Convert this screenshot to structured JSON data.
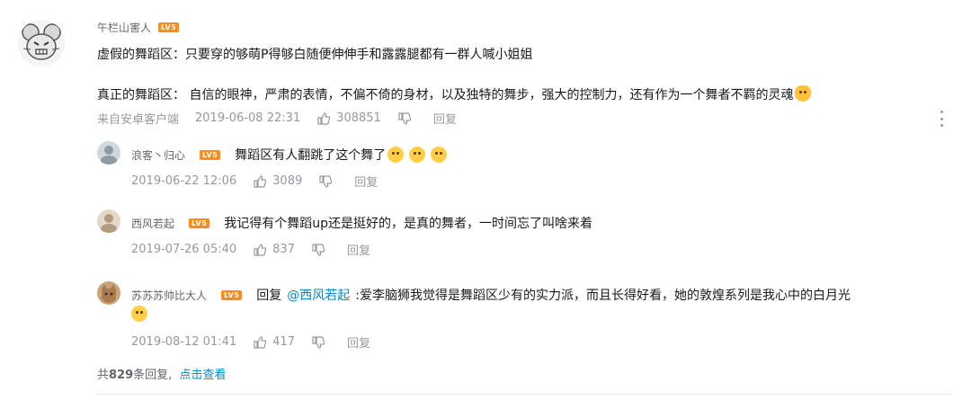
{
  "main_comment": {
    "username": "午栏山害人",
    "level": "LV5",
    "line1": "虚假的舞蹈区：只要穿的够萌P得够白随便伸伸手和露露腿都有一群人喊小姐姐",
    "line2": "真正的舞蹈区： 自信的眼神，严肃的表情，不偏不倚的身材，以及独特的舞步，强大的控制力，还有作为一个舞者不羁的灵魂",
    "source": "来自安卓客户端",
    "time": "2019-06-08 22:31",
    "likes": "308851",
    "reply_label": "回复",
    "emoji": "cat-emoji"
  },
  "replies": [
    {
      "username": "浪客丶归心",
      "level": "LV5",
      "text": "舞蹈区有人翻跳了这个舞了",
      "time": "2019-06-22 12:06",
      "likes": "3089",
      "reply_label": "回复"
    },
    {
      "username": "西风若起",
      "level": "LV5",
      "text": "我记得有个舞蹈up还是挺好的，是真的舞者，一时间忘了叫啥来着",
      "time": "2019-07-26 05:40",
      "likes": "837",
      "reply_label": "回复"
    },
    {
      "username": "苏苏苏帅比大人",
      "level": "LV5",
      "reply_prefix": "回复",
      "mention": "@西风若起",
      "text": ":爱李脑狮我觉得是舞蹈区少有的实力派，而且长得好看，她的敦煌系列是我心中的白月光",
      "time": "2019-08-12 01:41",
      "likes": "417",
      "reply_label": "回复"
    }
  ],
  "footer": {
    "prefix": "共",
    "count": "829",
    "suffix": "条回复,",
    "view_more": "点击查看"
  },
  "colors": {
    "level_badge": "#ff8c1a",
    "link": "#008ac5",
    "meta": "#9499a0"
  }
}
